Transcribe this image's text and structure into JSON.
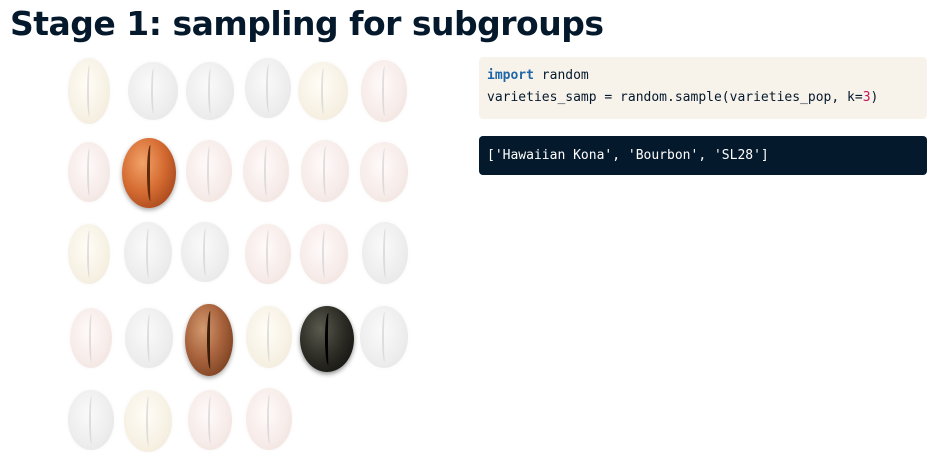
{
  "slide": {
    "title": "Stage 1: sampling for subgroups"
  },
  "code": {
    "line1_keyword": "import",
    "line1_rest": " random",
    "line2_pre": "varieties_samp = random.sample(varieties_pop, k=",
    "line2_num": "3",
    "line2_post": ")"
  },
  "output": {
    "text": "['Hawaiian Kona', 'Bourbon', 'SL28']"
  },
  "colors": {
    "title": "#05192d",
    "code_background": "#f7f3eb",
    "output_background": "#05192d",
    "keyword": "#1f67a8",
    "number": "#c2185b"
  },
  "beans": {
    "rows": [
      [
        "faded",
        "faded",
        "faded",
        "faded",
        "faded",
        "faded"
      ],
      [
        "faded",
        "selected",
        "faded",
        "faded",
        "faded",
        "faded"
      ],
      [
        "faded",
        "faded",
        "faded",
        "faded",
        "faded",
        "faded"
      ],
      [
        "faded",
        "faded",
        "selected",
        "faded",
        "selected",
        "faded"
      ],
      [
        "faded",
        "faded",
        "faded",
        "faded"
      ]
    ],
    "selected_count": 3,
    "icon": "coffee-bean-icon"
  }
}
